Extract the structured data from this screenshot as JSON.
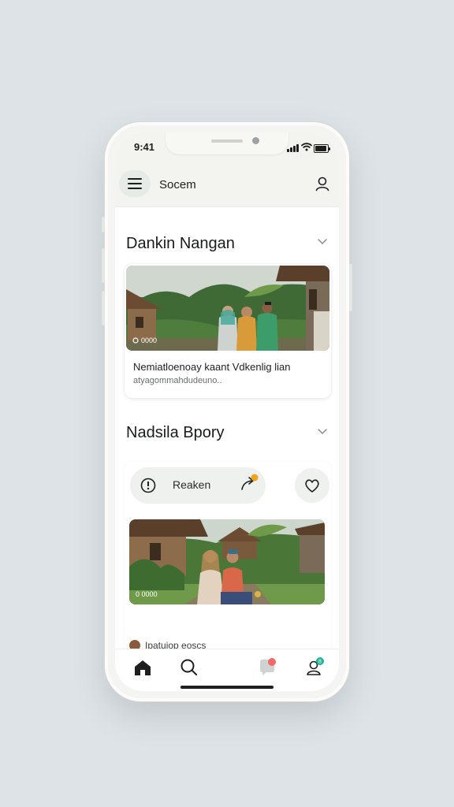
{
  "status_bar": {
    "time": "9:41"
  },
  "app_bar": {
    "title": "Socem",
    "menu_icon": "hamburger-icon",
    "user_icon": "user-icon"
  },
  "sections": [
    {
      "heading": "Dankin Nangan",
      "card": {
        "photo_badge": "0000",
        "title": "Nemiatloenoay kaant Vdkenlig lian",
        "subtitle": "atyagommahdudeuno.."
      }
    },
    {
      "heading": "Nadsila Bpory",
      "pill_label": "Reaken",
      "card": {
        "photo_badge": "0 0000"
      }
    }
  ],
  "teaser": {
    "text": "Ipatuiop eoscs"
  },
  "tabbar": {
    "items": [
      "home-icon",
      "search-icon",
      "chat-icon",
      "profile-icon"
    ]
  },
  "colors": {
    "badge_orange": "#f0a41c",
    "badge_teal": "#20b39a",
    "chat_dot": "#f06a6a"
  }
}
